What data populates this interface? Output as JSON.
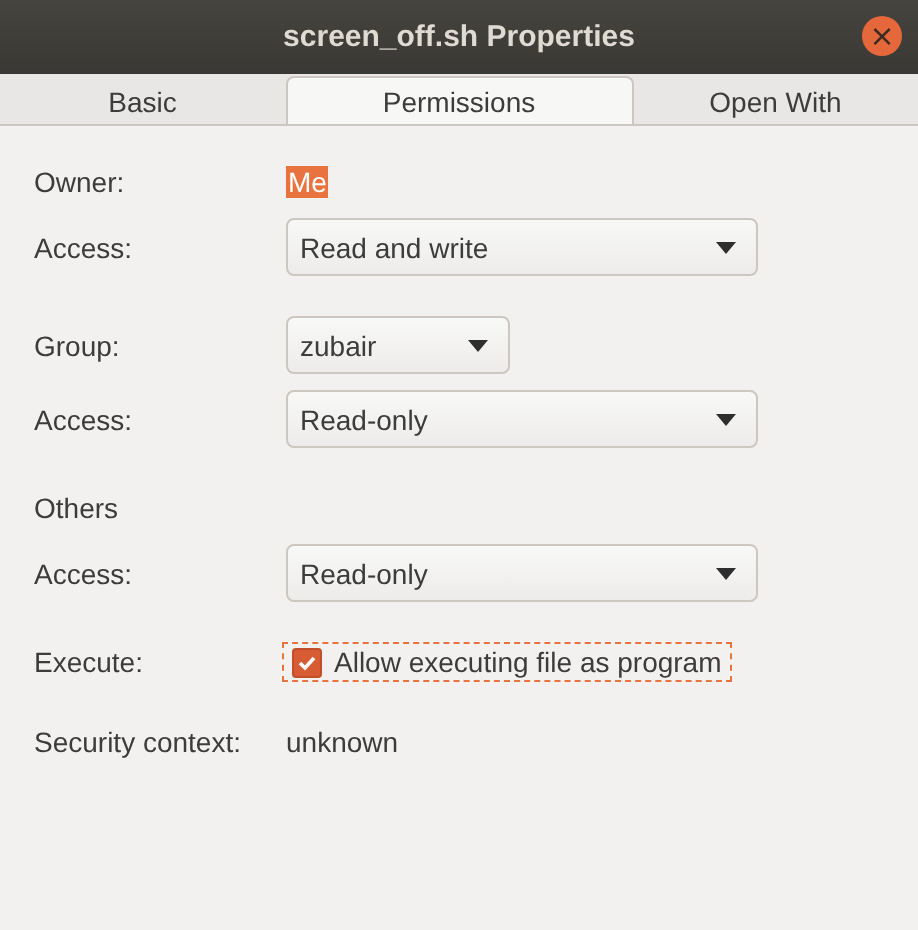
{
  "window": {
    "title": "screen_off.sh Properties",
    "close": "×"
  },
  "tabs": [
    {
      "label": "Basic",
      "selected": false
    },
    {
      "label": "Permissions",
      "selected": true
    },
    {
      "label": "Open With",
      "selected": false
    }
  ],
  "sections": [
    {
      "rows": [
        {
          "kind": "text",
          "label": "Owner:",
          "value": "Me",
          "selected": true
        },
        {
          "kind": "combo",
          "label": "Access:",
          "value": "Read and write"
        }
      ]
    },
    {
      "rows": [
        {
          "kind": "small-combo",
          "label": "Group:",
          "value": "zubair"
        },
        {
          "kind": "combo",
          "label": "Access:",
          "value": "Read-only"
        }
      ]
    },
    {
      "rows": [
        {
          "kind": "heading",
          "label": "Others"
        },
        {
          "kind": "combo",
          "label": "Access:",
          "value": "Read-only"
        }
      ]
    },
    {
      "rows": [
        {
          "kind": "checkbox",
          "label": "Execute:",
          "value": "Allow executing file as program",
          "checked": true,
          "focused": true
        }
      ]
    },
    {
      "rows": [
        {
          "kind": "text",
          "label": "Security context:",
          "value": "unknown",
          "selected": false
        }
      ]
    }
  ]
}
